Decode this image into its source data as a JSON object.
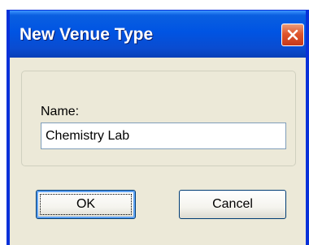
{
  "dialog": {
    "title": "New Venue Type",
    "close_icon": "close-icon",
    "name_label": "Name:",
    "name_value": "Chemistry Lab",
    "ok_label": "OK",
    "cancel_label": "Cancel"
  },
  "colors": {
    "titlebar": "#0054e3",
    "close_button": "#e0562c",
    "dialog_background": "#ece9d8"
  }
}
